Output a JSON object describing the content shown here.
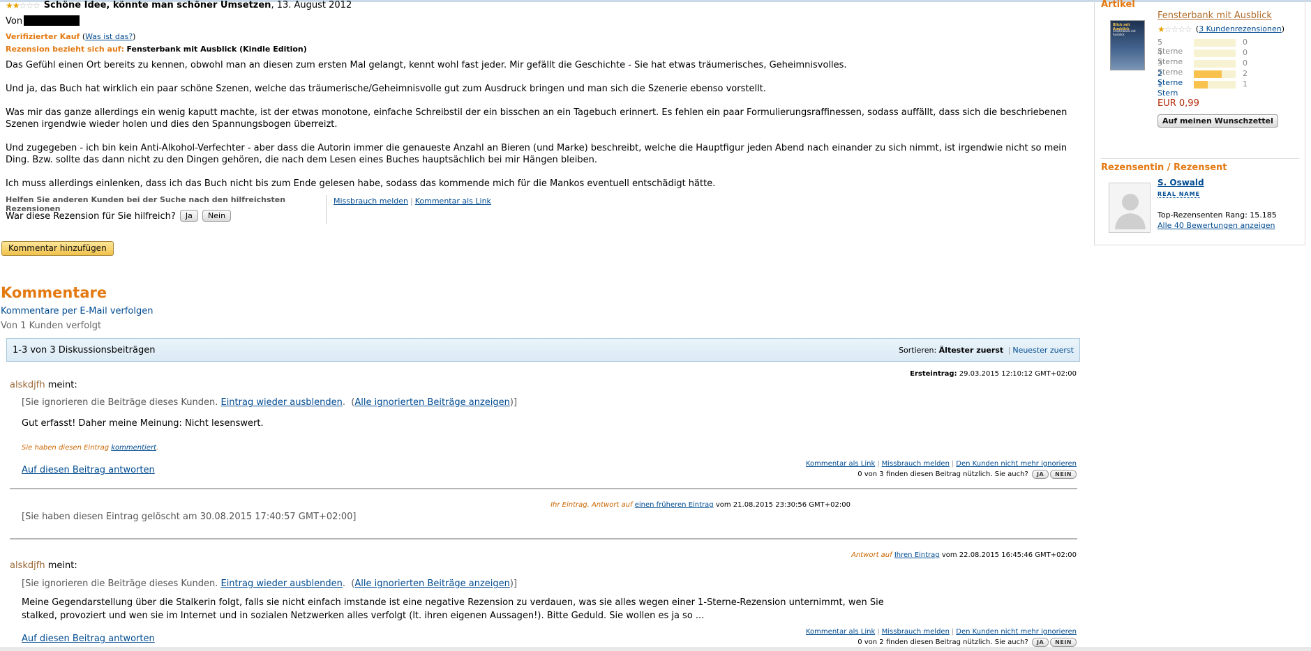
{
  "review": {
    "stars_filled": "★★",
    "stars_empty": "☆☆☆",
    "title": "Schöne Idee, könnte man schöner Umsetzen",
    "date": ", 13. August 2012",
    "von_label": "Von",
    "verified_label": "Verifizierter Kauf",
    "what_is_that": "Was ist das?",
    "refers_label": "Rezension bezieht sich auf:",
    "refers_product": "Fensterbank mit Ausblick (Kindle Edition)",
    "paragraphs": [
      "Das Gefühl einen Ort bereits zu kennen, obwohl man an diesen zum ersten Mal gelangt, kennt wohl fast jeder. Mir gefällt die Geschichte - Sie hat etwas träumerisches, Geheimnisvolles.",
      "Und ja, das Buch hat wirklich ein paar schöne Szenen, welche das träumerische/Geheimnisvolle gut zum Ausdruck bringen und man sich die Szenerie ebenso vorstellt.",
      "Was mir das ganze allerdings ein wenig kaputt machte, ist der etwas monotone, einfache Schreibstil der ein bisschen an ein Tagebuch erinnert. Es fehlen ein paar Formulierungsraffinessen, sodass auffällt, dass sich die beschriebenen Szenen irgendwie wieder holen und dies den Spannungsbogen überreizt.",
      "Und zugegeben - ich bin kein Anti-Alkohol-Verfechter - aber dass die Autorin immer die genaueste Anzahl an Bieren (und Marke) beschreibt, welche die Hauptfigur jeden Abend nach einander zu sich nimmt, ist irgendwie nicht so mein Ding. Bzw. sollte das dann nicht zu den Dingen gehören, die nach dem Lesen eines Buches hauptsächlich bei mir Hängen bleiben.",
      "Ich muss allerdings einlenken, dass ich das Buch nicht bis zum Ende gelesen habe, sodass das kommende mich für die Mankos eventuell entschädigt hätte."
    ],
    "helpful_prompt": "Helfen Sie anderen Kunden bei der Suche nach den hilfreichsten Rezensionen",
    "helpful_question": "War diese Rezension für Sie hilfreich?",
    "yes_label": "Ja",
    "no_label": "Nein",
    "report_label": "Missbrauch melden",
    "comment_link_label": "Kommentar als Link",
    "add_comment_label": "Kommentar hinzufügen"
  },
  "comments": {
    "title": "Kommentare",
    "follow_email": "Kommentare per E-Mail verfolgen",
    "followed_by": "Von 1 Kunden verfolgt",
    "count_label": "1-3 von 3 Diskussionsbeiträgen",
    "sort_label": "Sortieren:",
    "sort_oldest": "Ältester zuerst",
    "sort_newest": "Neuester zuerst",
    "posts": [
      {
        "meta_label": "Ersteintrag:",
        "meta_date": "29.03.2015 12:10:12 GMT+02:00",
        "author": "alskdjfh",
        "says": "meint:",
        "ignored_text": "[Sie ignorieren die Beiträge dieses Kunden.",
        "hide_again": "Eintrag wieder ausblenden",
        "show_all_ignored": "Alle ignorierten Beiträge anzeigen",
        "text": "Gut erfasst! Daher meine Meinung: Nicht lesenswert.",
        "you_commented_prefix": "Sie haben diesen Eintrag",
        "you_commented_link": "kommentiert",
        "reply": "Auf diesen Beitrag antworten",
        "comment_link": "Kommentar als Link",
        "report": "Missbrauch melden",
        "unignore": "Den Kunden nicht mehr ignorieren",
        "useful_text": "0 von 3 finden diesen Beitrag nützlich. Sie auch?",
        "ja": "JA",
        "nein": "NEIN"
      },
      {
        "meta_prefix": "Ihr Eintrag, Antwort auf",
        "meta_link": "einen früheren Eintrag",
        "meta_date": "vom 21.08.2015 23:30:56 GMT+02:00",
        "deleted_text": "[Sie haben diesen Eintrag gelöscht am 30.08.2015 17:40:57 GMT+02:00]"
      },
      {
        "meta_prefix": "Antwort auf",
        "meta_link": "Ihren Eintrag",
        "meta_date": "vom 22.08.2015 16:45:46 GMT+02:00",
        "author": "alskdjfh",
        "says": "meint:",
        "ignored_text": "[Sie ignorieren die Beiträge dieses Kunden.",
        "hide_again": "Eintrag wieder ausblenden",
        "show_all_ignored": "Alle ignorierten Beiträge anzeigen",
        "text": "Meine Gegendarstellung über die Stalkerin folgt, falls sie nicht einfach imstande ist eine negative Rezension zu verdauen, was sie alles wegen einer 1-Sterne-Rezension unternimmt, wen Sie stalked, provoziert und wen sie im Internet und in sozialen Netzwerken alles verfolgt (lt. ihren eigenen Aussagen!). Bitte Geduld. Sie wollen es ja so ...",
        "reply": "Auf diesen Beitrag antworten",
        "comment_link": "Kommentar als Link",
        "report": "Missbrauch melden",
        "unignore": "Den Kunden nicht mehr ignorieren",
        "useful_text": "0 von 2 finden diesen Beitrag nützlich. Sie auch?",
        "ja": "JA",
        "nein": "NEIN"
      }
    ]
  },
  "sidebar": {
    "article_heading": "Artikel",
    "cover_title": "Blick mit Ausblick",
    "cover_sub": "Fensterbank mit Ausblick",
    "product_title": "Fensterbank mit Ausblick",
    "rating_stars_filled": "★",
    "rating_stars_empty": "☆☆☆☆",
    "reviews_link": "3 Kundenrezensionen",
    "distribution": [
      {
        "label": "5 Sterne",
        "count": "0",
        "fraction": 0,
        "link": false
      },
      {
        "label": "4 Sterne",
        "count": "0",
        "fraction": 0,
        "link": false
      },
      {
        "label": "3 Sterne",
        "count": "0",
        "fraction": 0,
        "link": false
      },
      {
        "label": "2 Sterne",
        "count": "2",
        "fraction": 0.667,
        "link": true
      },
      {
        "label": "1 Stern",
        "count": "1",
        "fraction": 0.333,
        "link": true
      }
    ],
    "price": "EUR 0,99",
    "wishlist_label": "Auf meinen Wunschzettel",
    "reviewer_heading": "Rezensentin / Rezensent",
    "reviewer_name": "S. Oswald",
    "real_name": "REAL NAME",
    "rank": "Top-Rezensenten Rang: 15.185",
    "all_ratings": "Alle 40 Bewertungen anzeigen"
  },
  "colors": {
    "accent_orange": "#e47911",
    "link_blue": "#004b91",
    "price_red": "#b12704"
  }
}
